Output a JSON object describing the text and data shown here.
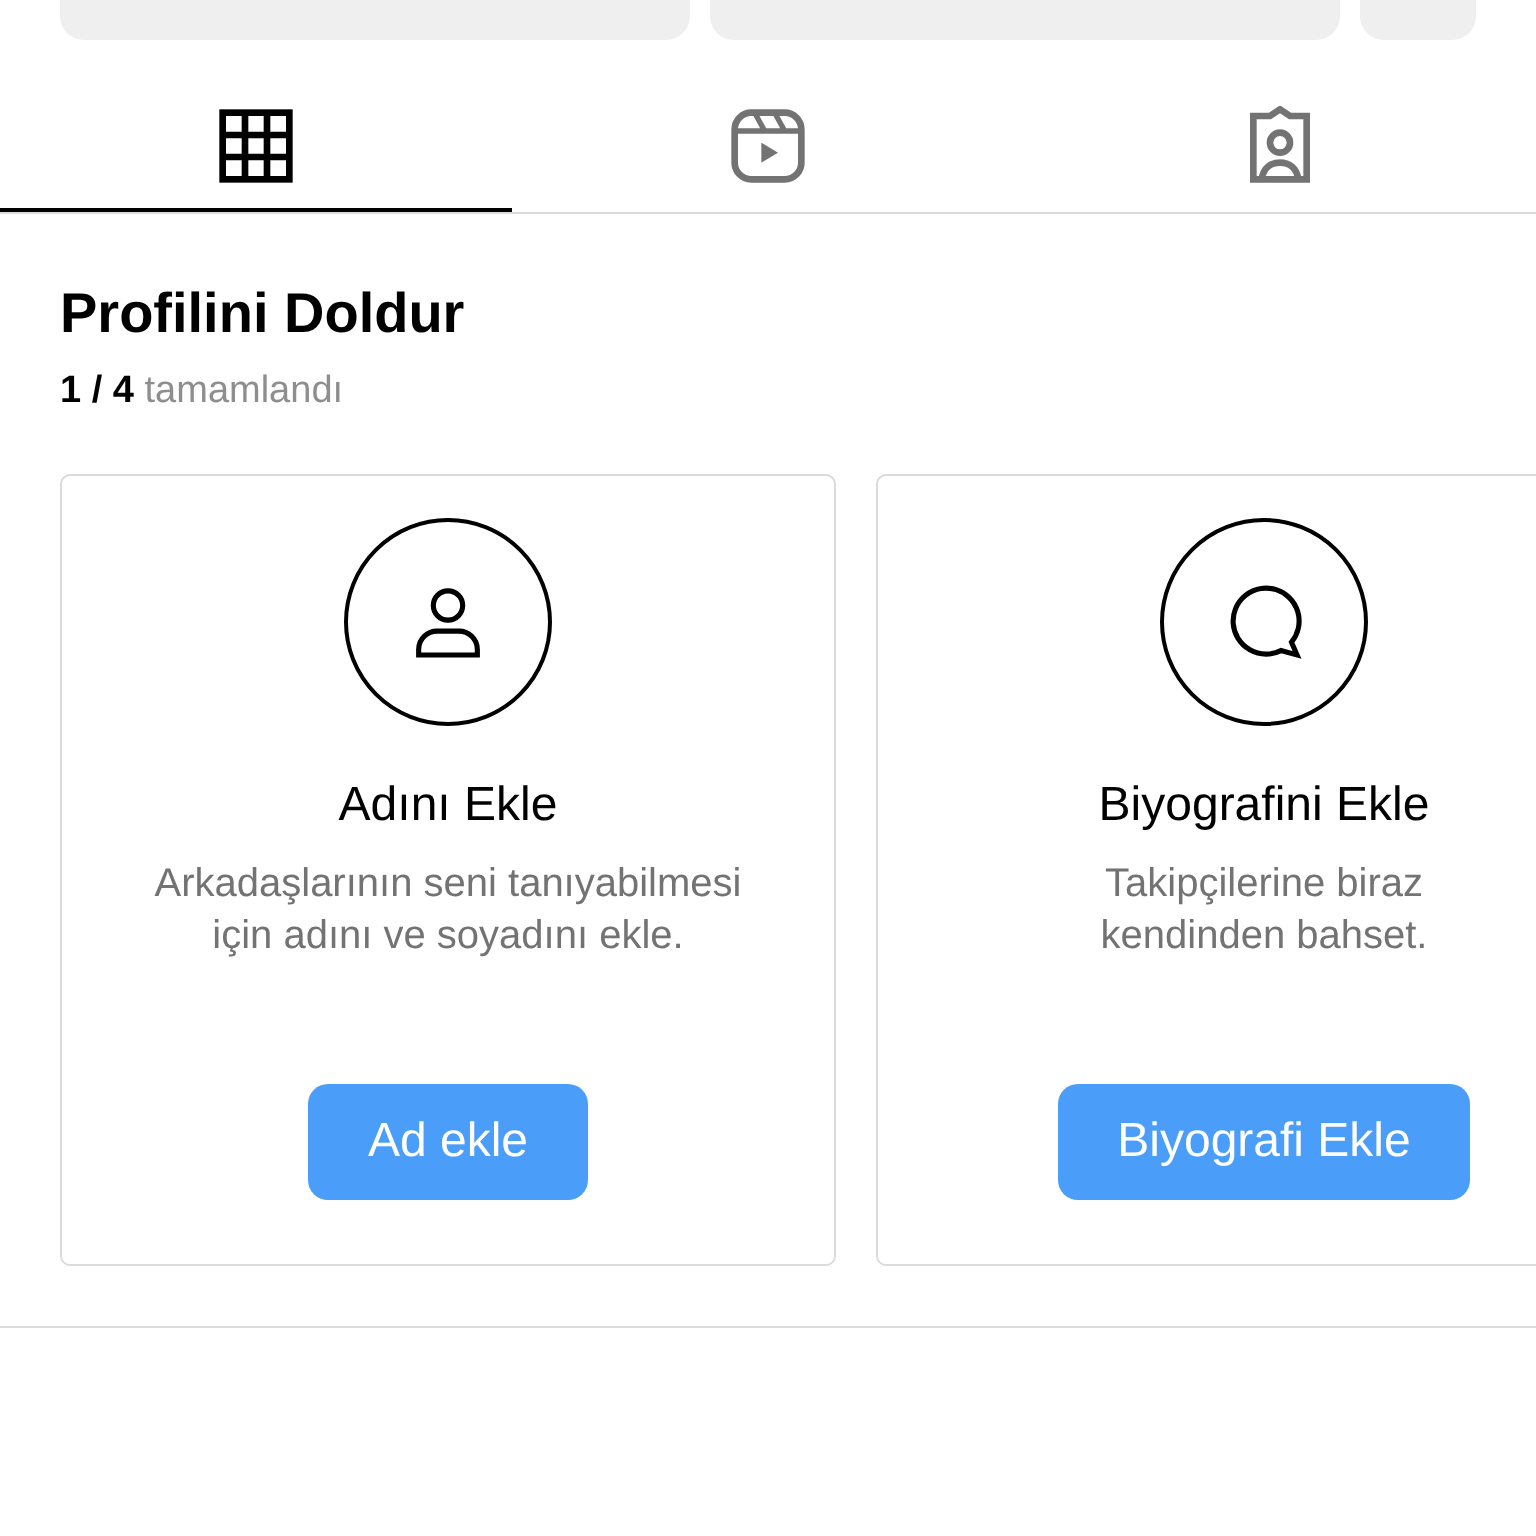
{
  "profile_buttons": [
    {
      "kind": "wide"
    },
    {
      "kind": "wide"
    },
    {
      "kind": "small"
    }
  ],
  "tabs": [
    {
      "kind": "grid",
      "selected": true
    },
    {
      "kind": "reels",
      "selected": false
    },
    {
      "kind": "tagged",
      "selected": false
    }
  ],
  "completion": {
    "title": "Profilini Doldur",
    "count": "1 / 4",
    "count_label": "tamamlandı"
  },
  "cards": [
    {
      "kind": "person",
      "title": "Adını Ekle",
      "description": [
        "Arkadaşlarının seni tanıyabilmesi",
        "için adını ve soyadını ekle."
      ],
      "button": "Ad ekle"
    },
    {
      "kind": "chat",
      "title": "Biyografini Ekle",
      "description": [
        "Takipçilerine biraz",
        "kendinden bahset."
      ],
      "button": "Biyografi Ekle"
    }
  ]
}
